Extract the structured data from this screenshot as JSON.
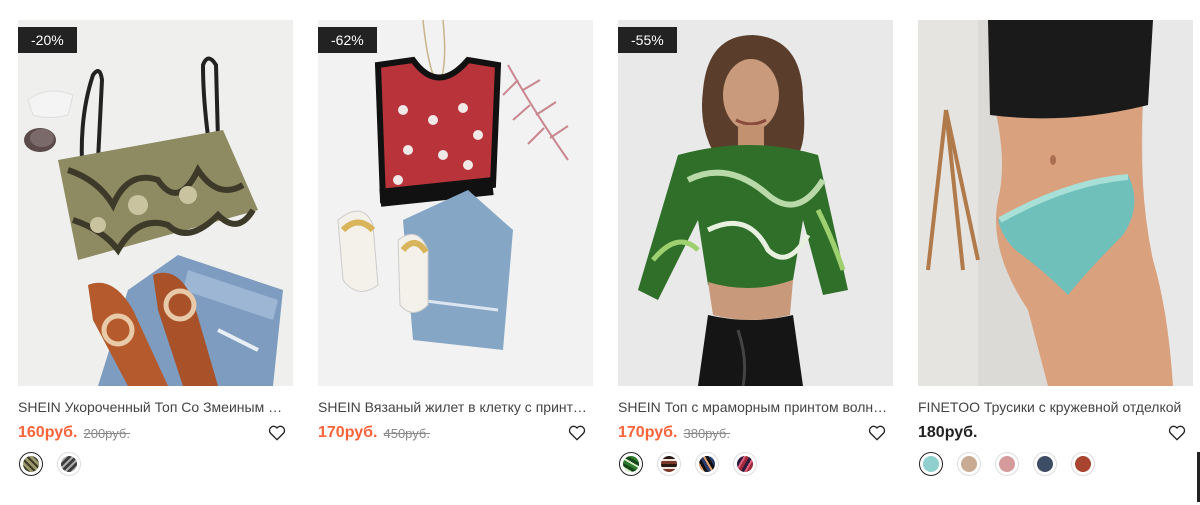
{
  "products": [
    {
      "badge": "-20%",
      "title": "SHEIN Укороченный Топ Со Змеиным Принтом",
      "price": "160руб.",
      "old_price": "200руб.",
      "swatches": [
        "#9a9a6a",
        "#3c3c3c"
      ],
      "swatch_icons": [
        "snake-print-swatch-icon",
        "dark-print-swatch-icon"
      ]
    },
    {
      "badge": "-62%",
      "title": "SHEIN Вязаный жилет в клетку с принтом снежинки",
      "price": "170руб.",
      "old_price": "450руб.",
      "swatches": [],
      "swatch_icons": []
    },
    {
      "badge": "-55%",
      "title": "SHEIN Топ с мраморным принтом волнистый край",
      "price": "170руб.",
      "old_price": "380руб.",
      "swatches": [
        "#2d7a2a",
        "#7a3a2a",
        "#2a3a6a",
        "#a0283a"
      ],
      "swatch_icons": [
        "green-marble-swatch-icon",
        "brown-stripe-swatch-icon",
        "blue-pattern-swatch-icon",
        "red-pattern-swatch-icon"
      ]
    },
    {
      "badge": "",
      "title": "FINETOO Трусики с кружевной отделкой",
      "price": "180руб.",
      "old_price": "",
      "swatches": [
        "#8fd0cf",
        "#c9aa92",
        "#d49a9c",
        "#3e4d66",
        "#a8442f"
      ],
      "swatch_icons": [
        "mint-swatch-icon",
        "beige-swatch-icon",
        "pink-swatch-icon",
        "navy-swatch-icon",
        "rust-swatch-icon"
      ]
    }
  ],
  "colors": {
    "sale": "#fa6338",
    "badge_bg": "#222222"
  }
}
